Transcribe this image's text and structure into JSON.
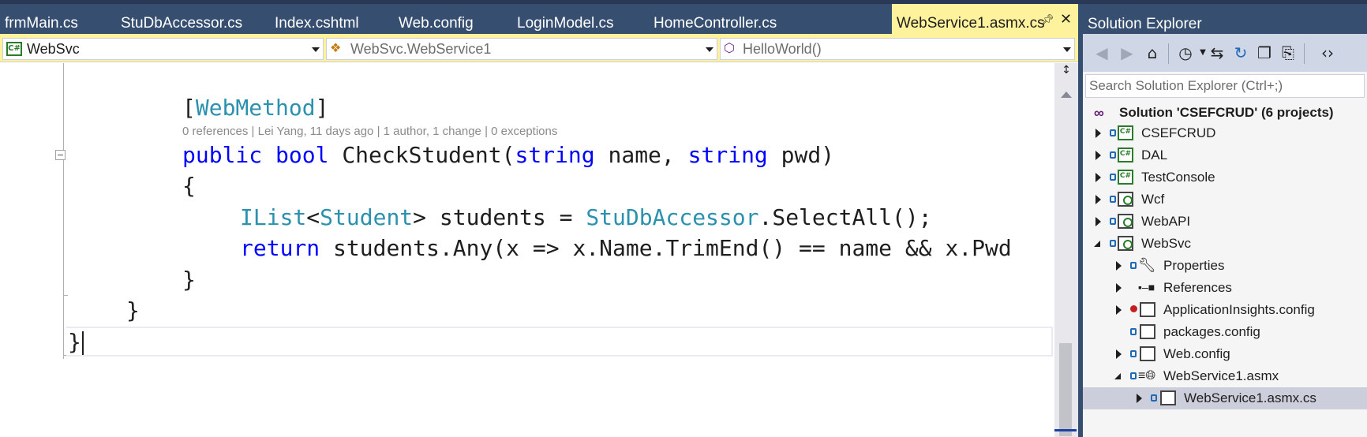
{
  "tabs": [
    {
      "label": "frmMain.cs"
    },
    {
      "label": "StuDbAccessor.cs"
    },
    {
      "label": "Index.cshtml"
    },
    {
      "label": "Web.config"
    },
    {
      "label": "LoginModel.cs"
    },
    {
      "label": "HomeController.cs"
    }
  ],
  "active_tab": {
    "label": "WebService1.asmx.cs"
  },
  "navbar": {
    "project": "WebSvc",
    "type": "WebSvc.WebService1",
    "member": "HelloWorld()"
  },
  "code": {
    "attr_open": "[",
    "attr_name": "WebMethod",
    "attr_close": "]",
    "codelens": "0 references | Lei Yang, 11 days ago | 1 author, 1 change | 0 exceptions",
    "l3_public": "public",
    "l3_bool": "bool",
    "l3_name": "CheckStudent(",
    "l3_string1": "string",
    "l3_p1": " name, ",
    "l3_string2": "string",
    "l3_p2": " pwd)",
    "l4": "{",
    "l5_ilist": "IList",
    "l5_lt": "<",
    "l5_student": "Student",
    "l5_gt": "> students = ",
    "l5_acc": "StuDbAccessor",
    "l5_rest": ".SelectAll();",
    "l6_return": "return",
    "l6_rest": " students.Any(x => x.Name.TrimEnd() == name && x.Pwd",
    "l7": "}",
    "l8": "}",
    "l9": "}"
  },
  "solution_explorer": {
    "title": "Solution Explorer",
    "search_placeholder": "Search Solution Explorer (Ctrl+;)",
    "solution": "Solution 'CSEFCRUD' (6 projects)",
    "projects": [
      {
        "name": "CSEFCRUD",
        "badge": "C#"
      },
      {
        "name": "DAL",
        "badge": "C#"
      },
      {
        "name": "TestConsole",
        "badge": "C#"
      },
      {
        "name": "Wcf"
      },
      {
        "name": "WebAPI"
      },
      {
        "name": "WebSvc"
      }
    ],
    "websvc_children": [
      {
        "name": "Properties"
      },
      {
        "name": "References"
      },
      {
        "name": "ApplicationInsights.config"
      },
      {
        "name": "packages.config"
      },
      {
        "name": "Web.config"
      },
      {
        "name": "WebService1.asmx"
      },
      {
        "name": "WebService1.asmx.cs"
      }
    ]
  },
  "colors": {
    "tab_bar": "#364e6f",
    "active_tab": "#fff29d",
    "keyword": "#0000ff",
    "type": "#2b91af",
    "selection": "#cccedb"
  }
}
